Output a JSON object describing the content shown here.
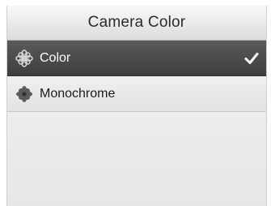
{
  "header": {
    "title": "Camera Color"
  },
  "options": [
    {
      "label": "Color",
      "icon": "color-flower-icon",
      "selected": true
    },
    {
      "label": "Monochrome",
      "icon": "monochrome-flower-icon",
      "selected": false
    }
  ],
  "colors": {
    "selected_row": "#4a4a4a",
    "background": "#eeeeee"
  }
}
